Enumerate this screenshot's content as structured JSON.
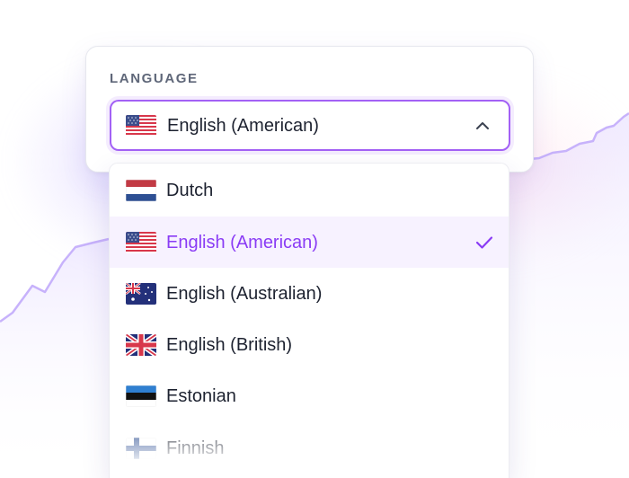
{
  "language_picker": {
    "label": "LANGUAGE",
    "selected": {
      "label": "English (American)",
      "flag_icon": "flag-us-icon"
    },
    "options": [
      {
        "label": "Dutch",
        "flag_icon": "flag-nl-icon",
        "selected": false
      },
      {
        "label": "English (American)",
        "flag_icon": "flag-us-icon",
        "selected": true
      },
      {
        "label": "English (Australian)",
        "flag_icon": "flag-au-icon",
        "selected": false
      },
      {
        "label": "English (British)",
        "flag_icon": "flag-gb-icon",
        "selected": false
      },
      {
        "label": "Estonian",
        "flag_icon": "flag-ee-icon",
        "selected": false
      },
      {
        "label": "Finnish",
        "flag_icon": "flag-fi-icon",
        "selected": false
      }
    ]
  },
  "colors": {
    "accent": "#8a3cf5",
    "border_focus": "#a361f5",
    "selected_bg": "#f7f2ff",
    "text": "#1d2230",
    "label": "#5f6779"
  }
}
